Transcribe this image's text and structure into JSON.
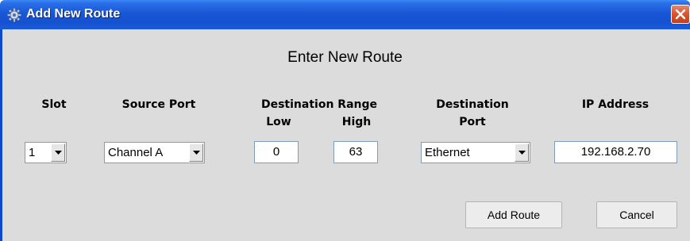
{
  "window": {
    "title": "Add New Route",
    "icon": "gear-icon",
    "close_icon": "close-icon",
    "titlebar_color": "#1a57d6",
    "close_color": "#d9532c"
  },
  "form": {
    "heading": "Enter New Route",
    "labels": {
      "slot": "Slot",
      "source_port": "Source Port",
      "destination_range": "Destination Range",
      "low": "Low",
      "high": "High",
      "destination_port_line1": "Destination",
      "destination_port_line2": "Port",
      "ip_address": "IP Address"
    },
    "values": {
      "slot": "1",
      "source_port": "Channel A",
      "low": "0",
      "high": "63",
      "destination_port": "Ethernet",
      "ip_address": "192.168.2.70"
    }
  },
  "buttons": {
    "add_route": "Add Route",
    "cancel": "Cancel"
  }
}
